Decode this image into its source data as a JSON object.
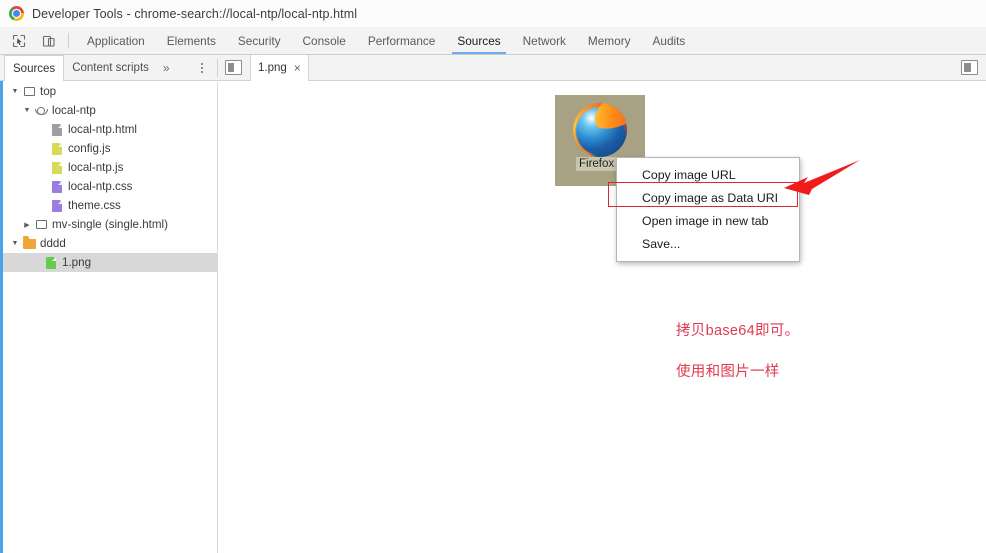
{
  "window": {
    "title": "Developer Tools - chrome-search://local-ntp/local-ntp.html",
    "logo_icon": "chrome-logo-icon"
  },
  "toolbar": {
    "inspect_icon": "inspect-element-icon",
    "device_icon": "device-toolbar-icon",
    "tabs": [
      {
        "label": "Application",
        "active": false
      },
      {
        "label": "Elements",
        "active": false
      },
      {
        "label": "Security",
        "active": false
      },
      {
        "label": "Console",
        "active": false
      },
      {
        "label": "Performance",
        "active": false
      },
      {
        "label": "Sources",
        "active": true
      },
      {
        "label": "Network",
        "active": false
      },
      {
        "label": "Memory",
        "active": false
      },
      {
        "label": "Audits",
        "active": false
      }
    ],
    "active_tab": "Sources",
    "accent_color": "#6aaaf0"
  },
  "subtoolbar": {
    "tabs": [
      {
        "label": "Sources",
        "active": true
      },
      {
        "label": "Content scripts",
        "active": false
      }
    ],
    "overflow_label": "»",
    "more_icon": "kebab-menu-icon",
    "navigator_toggle_icon": "toggle-navigator-icon",
    "right_panel_toggle_icon": "toggle-right-panel-icon",
    "file_tab": {
      "label": "1.png",
      "close_label": "×"
    }
  },
  "navigator": {
    "tree": [
      {
        "label": "top",
        "icon": "frame-icon",
        "indent": 0,
        "twisty": "▼",
        "selected": false
      },
      {
        "label": "local-ntp",
        "icon": "cloud-icon",
        "indent": 1,
        "twisty": "▼",
        "selected": false
      },
      {
        "label": "local-ntp.html",
        "icon": "file-html-icon",
        "indent": 2,
        "twisty": "",
        "selected": false
      },
      {
        "label": "config.js",
        "icon": "file-js-icon",
        "indent": 2,
        "twisty": "",
        "selected": false
      },
      {
        "label": "local-ntp.js",
        "icon": "file-js-icon",
        "indent": 2,
        "twisty": "",
        "selected": false
      },
      {
        "label": "local-ntp.css",
        "icon": "file-css-icon",
        "indent": 2,
        "twisty": "",
        "selected": false
      },
      {
        "label": "theme.css",
        "icon": "file-css-icon",
        "indent": 2,
        "twisty": "",
        "selected": false
      },
      {
        "label": "mv-single (single.html)",
        "icon": "frame-icon",
        "indent": 1,
        "twisty": "▶",
        "selected": false
      },
      {
        "label": "dddd",
        "icon": "folder-icon",
        "indent": 0,
        "twisty": "▼",
        "selected": false
      },
      {
        "label": "1.png",
        "icon": "file-image-icon",
        "indent": 1,
        "twisty": "",
        "selected": true
      }
    ]
  },
  "editor": {
    "image_preview": {
      "caption": "Firefox",
      "icon": "firefox-logo-icon",
      "background_color": "#a8a183"
    }
  },
  "context_menu": {
    "items": [
      {
        "label": "Copy image URL",
        "highlighted": false
      },
      {
        "label": "Copy image as Data URI",
        "highlighted": true
      },
      {
        "label": "Open image in new tab",
        "highlighted": false
      },
      {
        "label": "Save...",
        "highlighted": false
      }
    ],
    "highlight_color": "#e0262b"
  },
  "annotations": {
    "arrow_icon": "red-arrow-left-icon",
    "arrow_color": "#f01c1c",
    "text_color": "#e03a4e",
    "lines": [
      "拷贝base64即可。",
      "使用和图片一样"
    ]
  }
}
